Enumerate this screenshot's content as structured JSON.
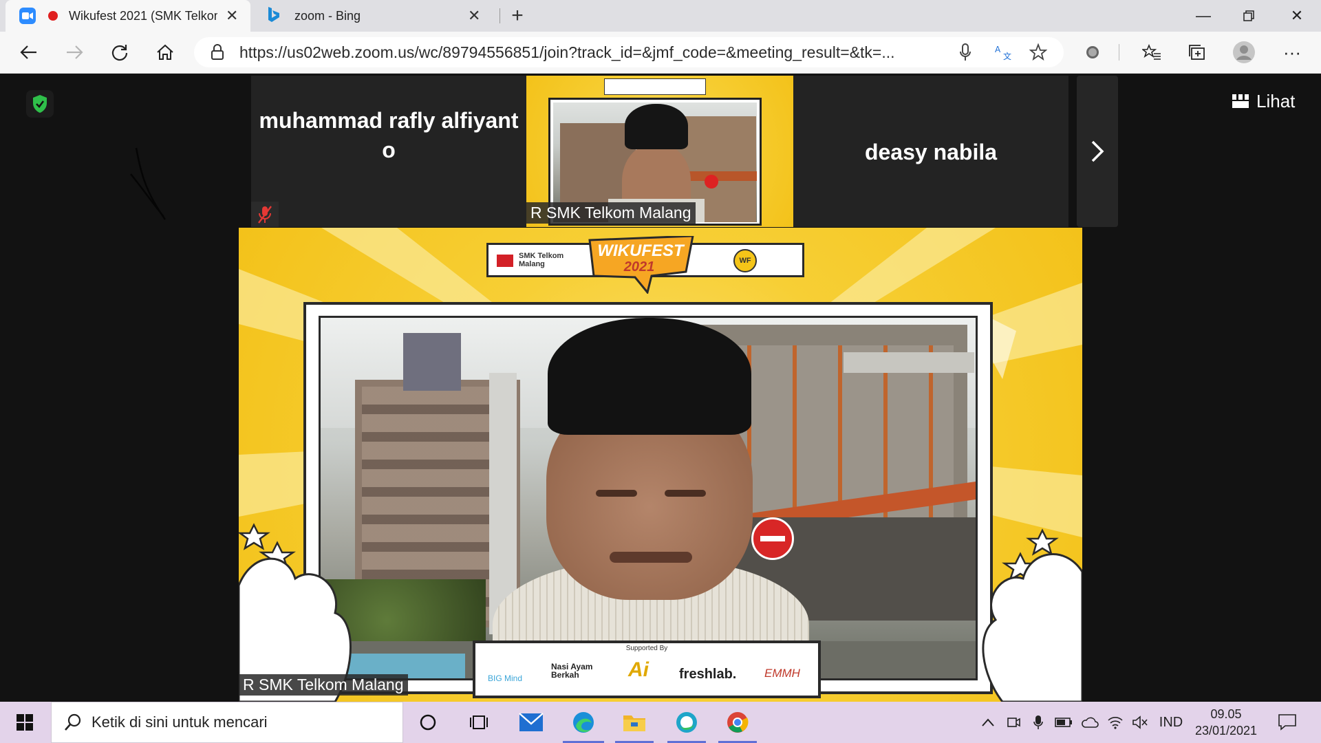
{
  "browser": {
    "tabs": [
      {
        "label": "Wikufest 2021 (SMK Telkom",
        "icon": "zoom-icon",
        "recording": true,
        "active": true
      },
      {
        "label": "zoom - Bing",
        "icon": "bing-icon",
        "active": false
      }
    ],
    "url": "https://us02web.zoom.us/wc/89794556851/join?track_id=&jmf_code=&meeting_result=&tk=..."
  },
  "meeting": {
    "view_button": "Lihat",
    "participants": [
      {
        "name_line1": "muhammad rafly alfiyant",
        "name_line2": "o",
        "muted": true
      },
      {
        "name": "R SMK Telkom Malang"
      },
      {
        "name": "deasy nabila"
      }
    ],
    "main_speaker": "R SMK Telkom Malang",
    "banner": {
      "school": "SMK Telkom Malang",
      "event": "WIKUFEST",
      "year": "2021",
      "badge": "WF"
    },
    "sponsors": {
      "heading": "Supported By",
      "items": [
        "BIG Mind",
        "Nasi Ayam Berkah",
        "Ai",
        "freshlab.",
        "EMMH"
      ]
    },
    "colors": {
      "accent_yellow": "#f7cf35",
      "muted_red": "#e53935",
      "shield_green": "#2fbf4a"
    }
  },
  "taskbar": {
    "search_placeholder": "Ketik di sini untuk mencari",
    "language": "IND",
    "time": "09.05",
    "date": "23/01/2021",
    "apps": [
      "cortana-icon",
      "task-view-icon",
      "mail-icon",
      "edge-icon",
      "file-explorer-icon",
      "opera-icon",
      "chrome-icon"
    ]
  }
}
